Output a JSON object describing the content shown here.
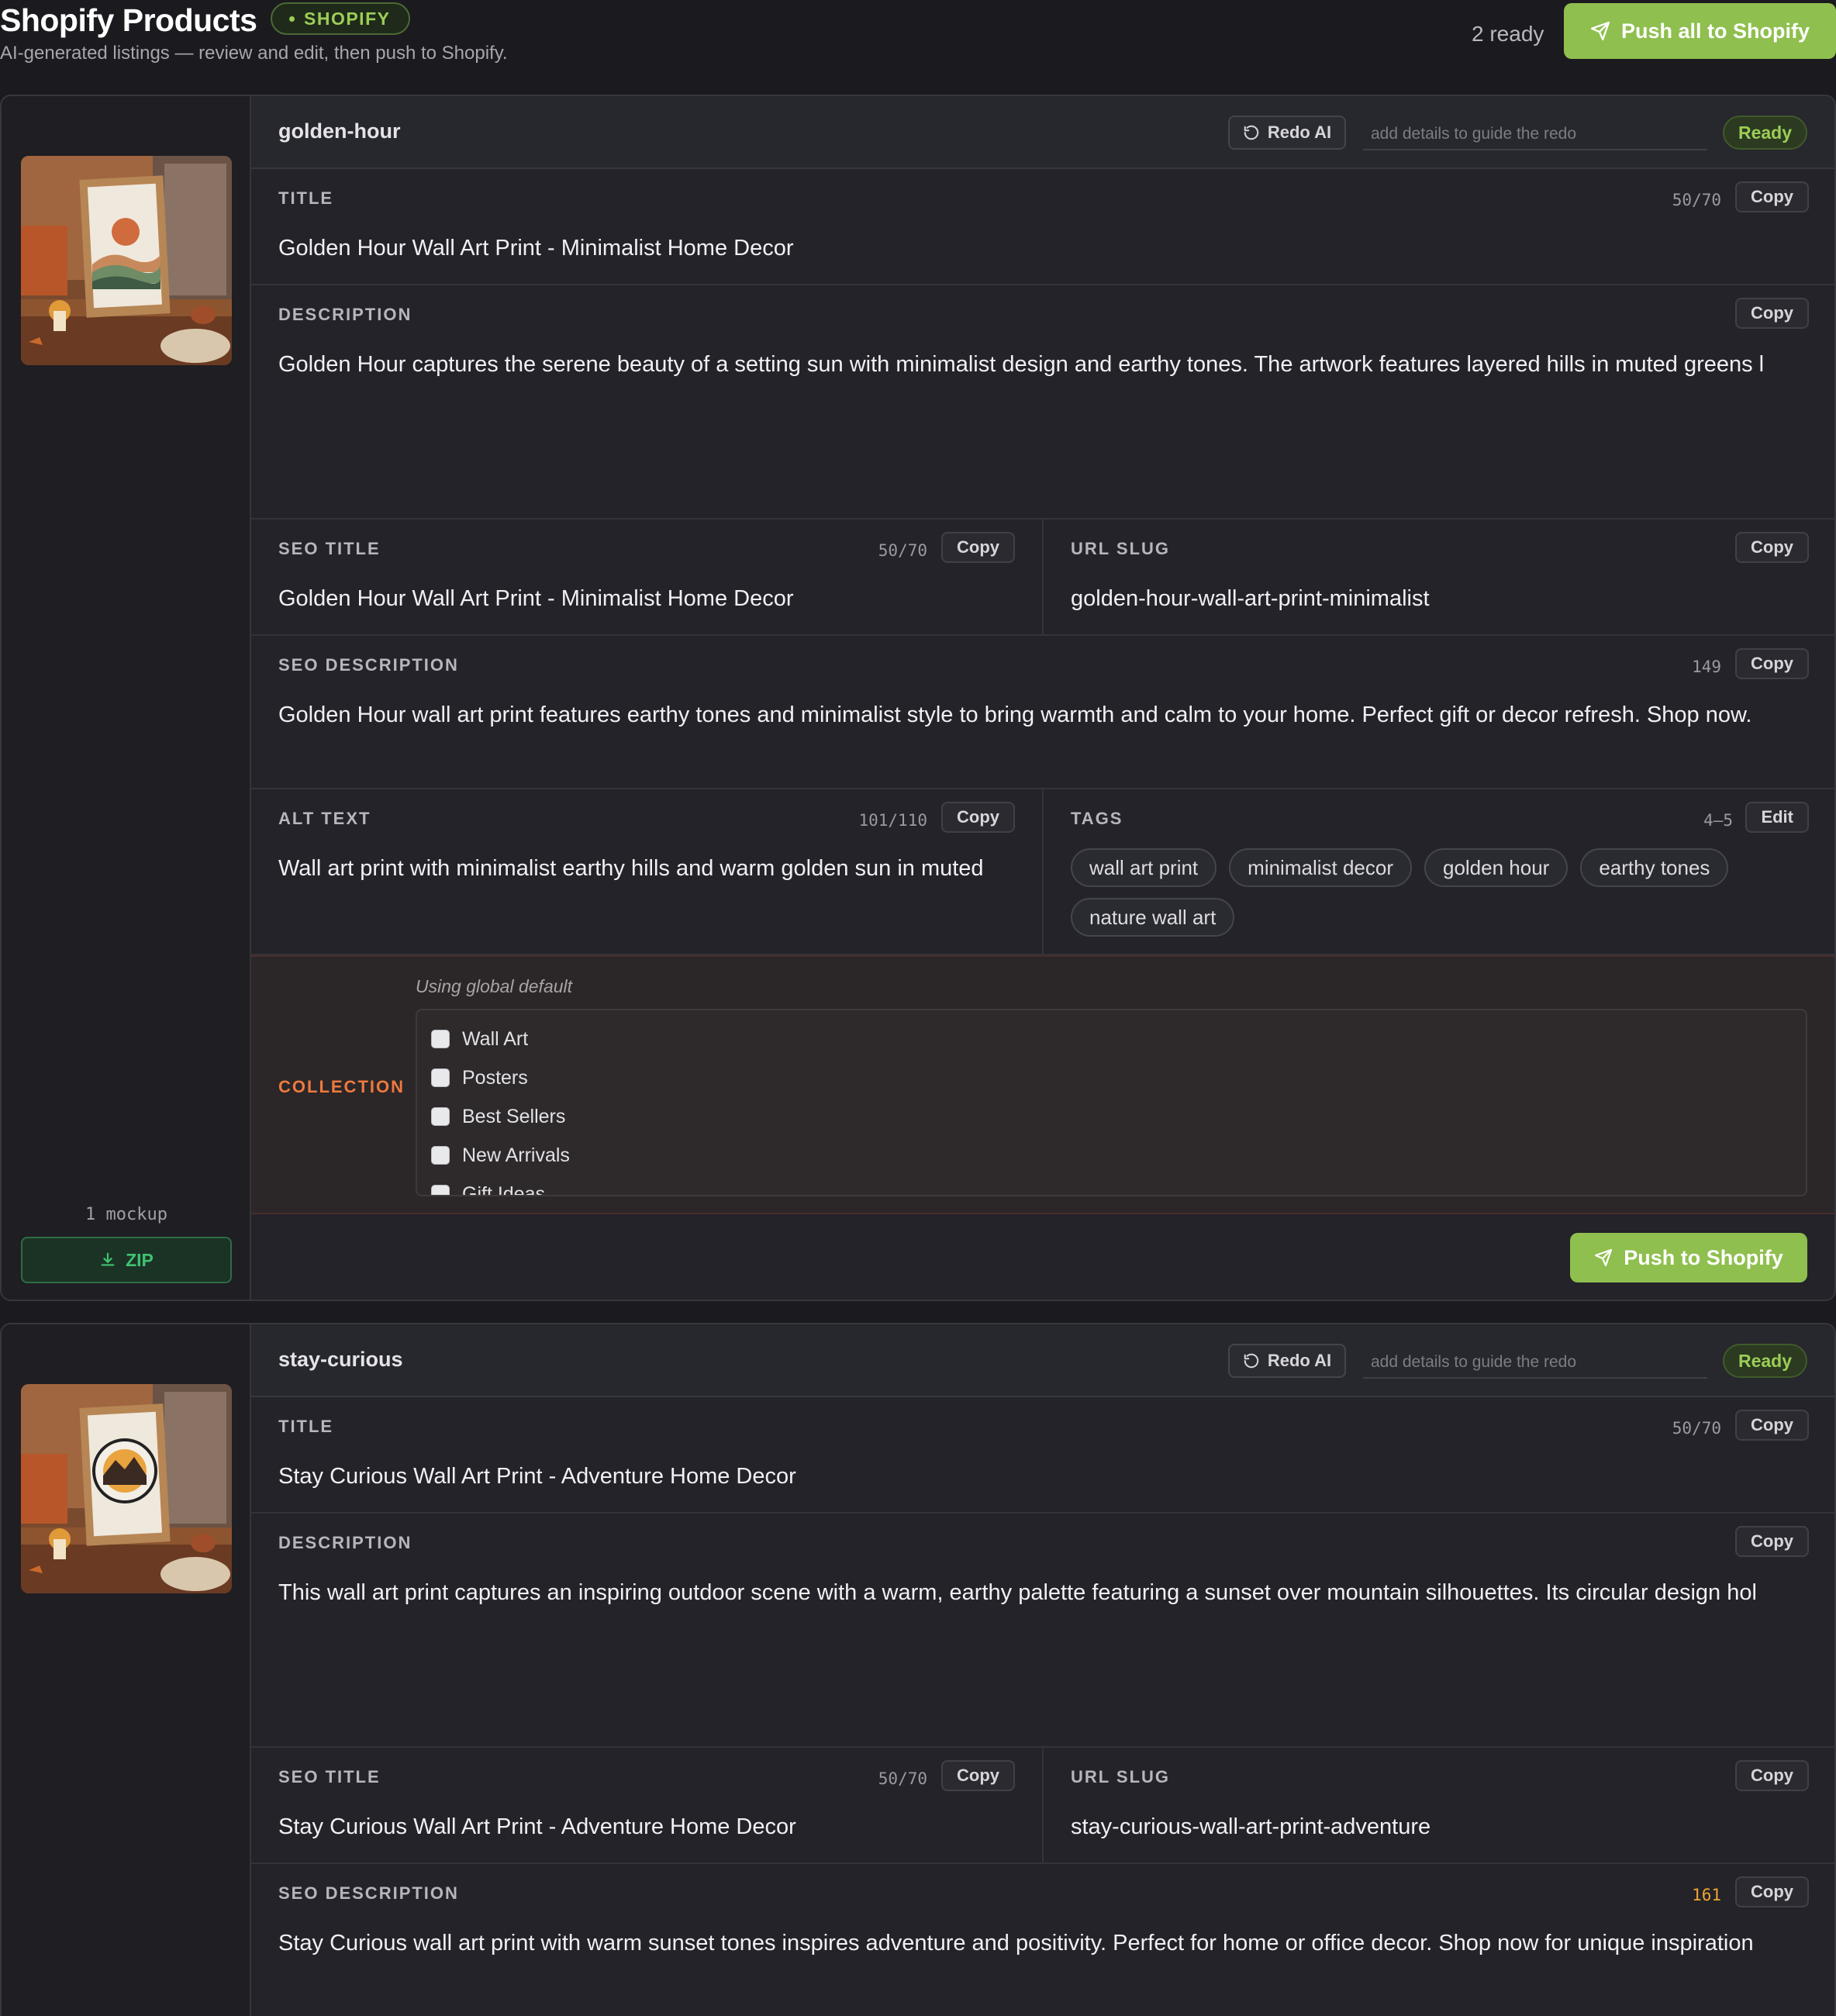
{
  "header": {
    "title": "Shopify Products",
    "badge": "SHOPIFY",
    "subtitle": "AI-generated listings — review and edit, then push to Shopify.",
    "ready_count": "2 ready",
    "push_all_label": "Push all to Shopify"
  },
  "labels": {
    "title": "TITLE",
    "description": "DESCRIPTION",
    "seo_title": "SEO TITLE",
    "url_slug": "URL SLUG",
    "seo_description": "SEO DESCRIPTION",
    "alt_text": "ALT TEXT",
    "tags": "TAGS",
    "collection": "COLLECTION",
    "copy": "Copy",
    "edit": "Edit",
    "redo": "Redo AI",
    "redo_placeholder": "add details to guide the redo",
    "push": "Push to Shopify",
    "zip": "ZIP",
    "collection_hint": "Using global default"
  },
  "collections": [
    "Wall Art",
    "Posters",
    "Best Sellers",
    "New Arrivals",
    "Gift Ideas"
  ],
  "products": [
    {
      "slug": "golden-hour",
      "status": "Ready",
      "mockups": "1 mockup",
      "title": "Golden Hour Wall Art Print - Minimalist Home Decor",
      "title_count": "50/70",
      "description": "Golden Hour captures the serene beauty of a setting sun with minimalist design and earthy tones. The artwork features layered hills in muted greens l",
      "seo_title": "Golden Hour Wall Art Print - Minimalist Home Decor",
      "seo_title_count": "50/70",
      "url_slug": "golden-hour-wall-art-print-minimalist",
      "seo_description": "Golden Hour wall art print features earthy tones and minimalist style to bring warmth and calm to your home. Perfect gift or decor refresh. Shop now.",
      "seo_description_count": "149",
      "alt_text": "Wall art print with minimalist earthy hills and warm golden sun in muted",
      "alt_text_count": "101/110",
      "tags_count": "4–5",
      "tags": [
        "wall art print",
        "minimalist decor",
        "golden hour",
        "earthy tones",
        "nature wall art"
      ]
    },
    {
      "slug": "stay-curious",
      "status": "Ready",
      "title": "Stay Curious Wall Art Print - Adventure Home Decor",
      "title_count": "50/70",
      "description": "This wall art print captures an inspiring outdoor scene with a warm, earthy palette featuring a sunset over mountain silhouettes. Its circular design hol",
      "seo_title": "Stay Curious Wall Art Print - Adventure Home Decor",
      "seo_title_count": "50/70",
      "url_slug": "stay-curious-wall-art-print-adventure",
      "seo_description": "Stay Curious wall art print with warm sunset tones inspires adventure and positivity. Perfect for home or office decor. Shop now for unique inspiration",
      "seo_description_count": "161"
    }
  ],
  "colors": {
    "accent_green": "#8fbf4e",
    "collection_label": "#ee7a3e",
    "over_limit": "#f0a530",
    "zip_green": "#3fc270"
  },
  "icons": {
    "push": "paper-plane-icon",
    "redo": "rotate-ccw-icon",
    "zip": "download-icon"
  }
}
